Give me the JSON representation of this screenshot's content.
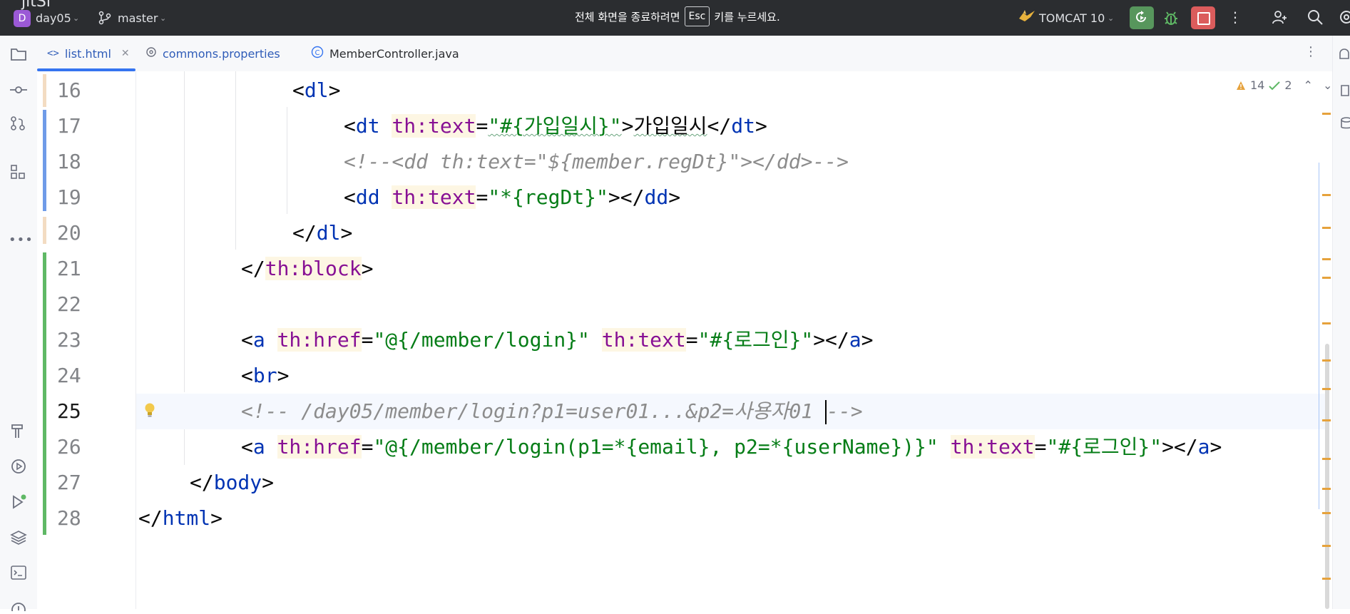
{
  "titlebar": {
    "logo_text": "jitSi",
    "project_badge": "D",
    "project_name": "day05",
    "branch_name": "master",
    "fullscreen_msg_before": "전체 화면을 종료하려면",
    "fullscreen_key": "Esc",
    "fullscreen_msg_after": "키를 누르세요.",
    "run_config": "TOMCAT 10"
  },
  "tabs": [
    {
      "label": "list.html",
      "icon": "html-file-icon",
      "active": true
    },
    {
      "label": "commons.properties",
      "icon": "properties-gear-icon",
      "active": false
    },
    {
      "label": "MemberController.java",
      "icon": "java-class-icon",
      "active": false
    }
  ],
  "inspections": {
    "warnings": "14",
    "weak_warnings": "2"
  },
  "editor": {
    "current_line": 25,
    "lines": [
      {
        "num": "16"
      },
      {
        "num": "17"
      },
      {
        "num": "18"
      },
      {
        "num": "19"
      },
      {
        "num": "20"
      },
      {
        "num": "21"
      },
      {
        "num": "22"
      },
      {
        "num": "23"
      },
      {
        "num": "24"
      },
      {
        "num": "25"
      },
      {
        "num": "26"
      },
      {
        "num": "27"
      },
      {
        "num": "28"
      }
    ],
    "code": {
      "l16_tag": "dl",
      "l17_tag": "dt",
      "l17_attr": "th:text",
      "l17_val": "\"#{가입일시}\"",
      "l17_text": "가입일시",
      "l18_comment": "<!--<dd th:text=\"${member.regDt}\"></dd>-->",
      "l19_tag": "dd",
      "l19_attr": "th:text",
      "l19_val": "\"*{regDt}\"",
      "l20_tag": "dl",
      "l21_tag": "th:block",
      "l23_tag": "a",
      "l23_attr1": "th:href",
      "l23_val1": "\"@{/member/login}\"",
      "l23_attr2": "th:text",
      "l23_val2": "\"#{로그인}\"",
      "l24_tag": "br",
      "l25_comment_a": "<!-- /day05/member/login?p1=user01...&p2=사용자01 ",
      "l25_comment_b": "-->",
      "l26_tag": "a",
      "l26_attr1": "th:href",
      "l26_val1": "\"@{/member/login(p1=*{email}, p2=*{userName})}\"",
      "l26_attr2": "th:text",
      "l26_val2": "\"#{로그인}\"",
      "l27_tag": "body",
      "l28_tag": "html"
    }
  },
  "colors": {
    "accent": "#3574f0",
    "tag": "#0033b3",
    "attribute": "#871094",
    "string": "#067d17",
    "comment": "#8c8c8c",
    "vcs_modified": "#6f9be8",
    "vcs_added": "#5fb865",
    "run": "#57965c",
    "stop": "#db5c5c"
  }
}
